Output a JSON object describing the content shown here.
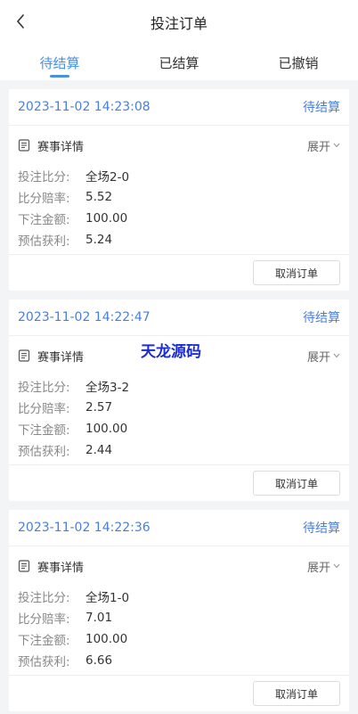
{
  "header": {
    "title": "投注订单"
  },
  "tabs": [
    {
      "label": "待结算",
      "active": true
    },
    {
      "label": "已结算",
      "active": false
    },
    {
      "label": "已撤销",
      "active": false
    }
  ],
  "labels": {
    "detail": "赛事详情",
    "expand": "展开",
    "bet_score": "投注比分:",
    "odds": "比分赔率:",
    "amount": "下注金额:",
    "profit": "预估获利:",
    "cancel": "取消订单"
  },
  "orders": [
    {
      "time": "2023-11-02 14:23:08",
      "status": "待结算",
      "score": "全场2-0",
      "odds": "5.52",
      "amount": "100.00",
      "profit": "5.24"
    },
    {
      "time": "2023-11-02 14:22:47",
      "status": "待结算",
      "score": "全场3-2",
      "odds": "2.57",
      "amount": "100.00",
      "profit": "2.44"
    },
    {
      "time": "2023-11-02 14:22:36",
      "status": "待结算",
      "score": "全场1-0",
      "odds": "7.01",
      "amount": "100.00",
      "profit": "6.66"
    }
  ],
  "watermark": "天龙源码",
  "icons": {
    "back": "chevron-left-icon",
    "detail": "document-icon",
    "expand": "chevron-down-icon"
  },
  "colors": {
    "accent": "#4a90e2",
    "watermark": "#1b2bd6"
  }
}
